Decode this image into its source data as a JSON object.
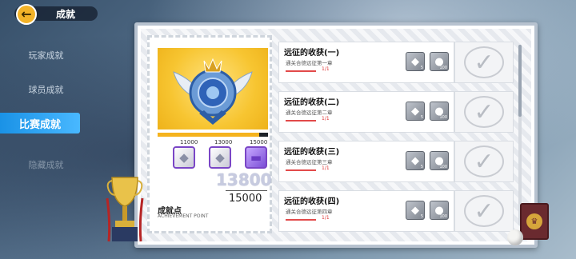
{
  "header": {
    "title": "成就",
    "back_icon": "arrow-left-icon"
  },
  "sidebar": {
    "items": [
      {
        "label": "玩家成就",
        "state": "normal"
      },
      {
        "label": "球员成就",
        "state": "normal"
      },
      {
        "label": "比赛成就",
        "state": "active"
      },
      {
        "label": "隐藏成就",
        "state": "dim"
      }
    ]
  },
  "achievement_card": {
    "emblem_icon": "winged-blue-crest-emblem",
    "milestones": [
      "11000",
      "13000",
      "15000"
    ],
    "progress_fraction": 0.92,
    "rewards": [
      {
        "icon": "diamond-icon"
      },
      {
        "icon": "diamond-icon"
      },
      {
        "icon": "ticket-icon"
      }
    ],
    "current_points": "13800",
    "total_points": "15000",
    "points_label": "成就点",
    "points_sublabel": "ACHIEVEMENT POINT"
  },
  "achievements": [
    {
      "title": "远征的收获(一)",
      "desc": "通关合德远征第一章",
      "progress": "1/1",
      "fraction": 1.0,
      "rewards": [
        {
          "icon": "diamond-icon",
          "qty": "5"
        },
        {
          "icon": "coin-icon",
          "qty": "100"
        }
      ],
      "status": "completed"
    },
    {
      "title": "远征的收获(二)",
      "desc": "通关合德远征第二章",
      "progress": "1/1",
      "fraction": 1.0,
      "rewards": [
        {
          "icon": "diamond-icon",
          "qty": "5"
        },
        {
          "icon": "coin-icon",
          "qty": "100"
        }
      ],
      "status": "completed"
    },
    {
      "title": "远征的收获(三)",
      "desc": "通关合德远征第三章",
      "progress": "1/1",
      "fraction": 1.0,
      "rewards": [
        {
          "icon": "diamond-icon",
          "qty": "5"
        },
        {
          "icon": "coin-icon",
          "qty": "100"
        }
      ],
      "status": "completed"
    },
    {
      "title": "远征的收获(四)",
      "desc": "通关合德远征第四章",
      "progress": "1/1",
      "fraction": 1.0,
      "rewards": [
        {
          "icon": "diamond-icon",
          "qty": "5"
        },
        {
          "icon": "coin-icon",
          "qty": "100"
        }
      ],
      "status": "completed"
    }
  ],
  "colors": {
    "accent": "#1a92e6",
    "gold": "#f5b31d",
    "progress_red": "#e24a4a"
  }
}
